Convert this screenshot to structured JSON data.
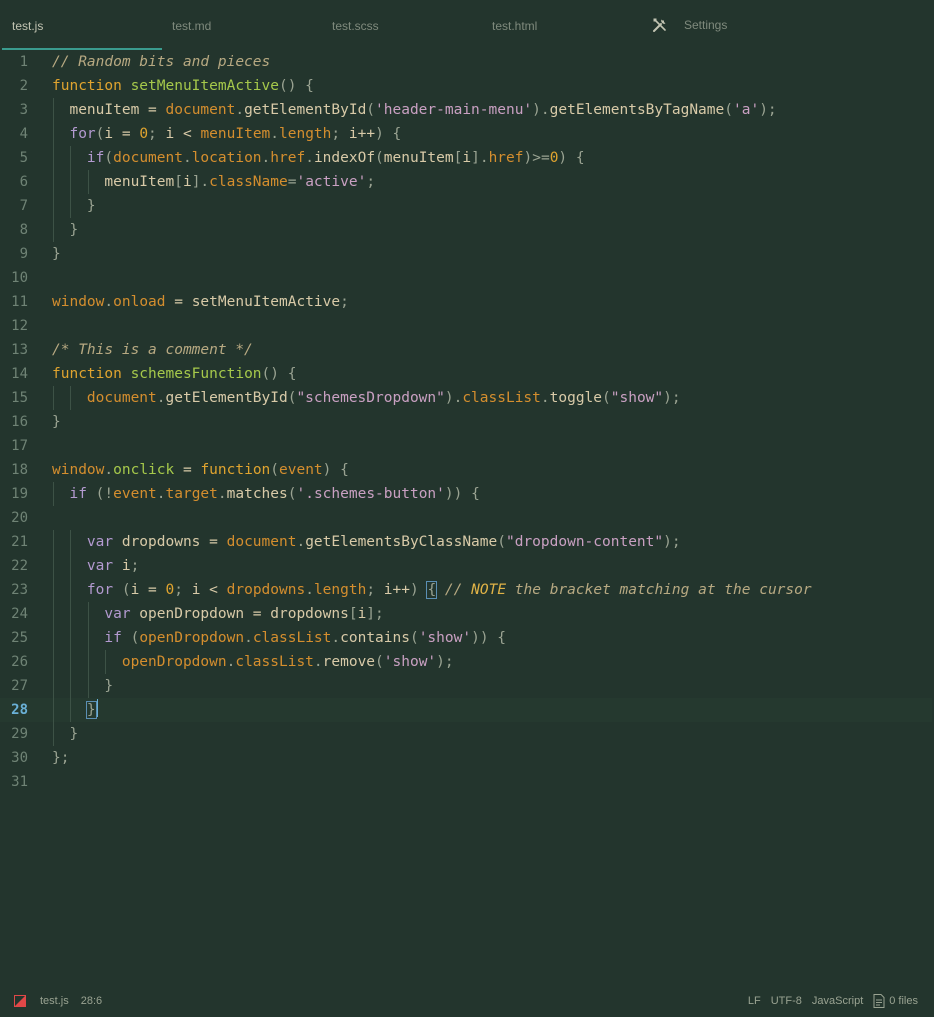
{
  "tabs": [
    {
      "label": "test.js",
      "active": true
    },
    {
      "label": "test.md",
      "active": false
    },
    {
      "label": "test.scss",
      "active": false
    },
    {
      "label": "test.html",
      "active": false
    },
    {
      "label": "Settings",
      "active": false,
      "icon": "tools-icon"
    }
  ],
  "editor": {
    "current_line": 28,
    "lines": [
      [
        [
          "cmt",
          "// Random bits and pieces"
        ]
      ],
      [
        [
          "kw",
          "function"
        ],
        [
          "txt",
          " "
        ],
        [
          "fn",
          "setMenuItemActive"
        ],
        [
          "pun",
          "() {"
        ]
      ],
      [
        [
          "txt",
          "  menuItem = "
        ],
        [
          "obj",
          "document"
        ],
        [
          "pun",
          "."
        ],
        [
          "txt",
          "getElementById"
        ],
        [
          "pun",
          "("
        ],
        [
          "str",
          "'header-main-menu'"
        ],
        [
          "pun",
          ")."
        ],
        [
          "txt",
          "getElementsByTagName"
        ],
        [
          "pun",
          "("
        ],
        [
          "str",
          "'a'"
        ],
        [
          "pun",
          ");"
        ]
      ],
      [
        [
          "for",
          "  for"
        ],
        [
          "pun",
          "("
        ],
        [
          "txt",
          "i = "
        ],
        [
          "num",
          "0"
        ],
        [
          "pun",
          "; "
        ],
        [
          "txt",
          "i < "
        ],
        [
          "obj",
          "menuItem"
        ],
        [
          "pun",
          "."
        ],
        [
          "prop",
          "length"
        ],
        [
          "pun",
          "; "
        ],
        [
          "txt",
          "i++"
        ],
        [
          "pun",
          ") {"
        ]
      ],
      [
        [
          "for",
          "    if"
        ],
        [
          "pun",
          "("
        ],
        [
          "obj",
          "document"
        ],
        [
          "pun",
          "."
        ],
        [
          "prop",
          "location"
        ],
        [
          "pun",
          "."
        ],
        [
          "prop",
          "href"
        ],
        [
          "pun",
          "."
        ],
        [
          "txt",
          "indexOf"
        ],
        [
          "pun",
          "("
        ],
        [
          "txt",
          "menuItem"
        ],
        [
          "pun",
          "["
        ],
        [
          "txt",
          "i"
        ],
        [
          "pun",
          "]."
        ],
        [
          "prop",
          "href"
        ],
        [
          "pun",
          ")>="
        ],
        [
          "num",
          "0"
        ],
        [
          "pun",
          ") {"
        ]
      ],
      [
        [
          "txt",
          "      menuItem"
        ],
        [
          "pun",
          "["
        ],
        [
          "txt",
          "i"
        ],
        [
          "pun",
          "]."
        ],
        [
          "prop",
          "className"
        ],
        [
          "pun",
          "="
        ],
        [
          "str",
          "'active'"
        ],
        [
          "pun",
          ";"
        ]
      ],
      [
        [
          "pun",
          "    }"
        ]
      ],
      [
        [
          "pun",
          "  }"
        ]
      ],
      [
        [
          "pun",
          "}"
        ]
      ],
      [
        [
          "txt",
          ""
        ]
      ],
      [
        [
          "obj",
          "window"
        ],
        [
          "pun",
          "."
        ],
        [
          "prop",
          "onload"
        ],
        [
          "txt",
          " = setMenuItemActive"
        ],
        [
          "pun",
          ";"
        ]
      ],
      [
        [
          "txt",
          ""
        ]
      ],
      [
        [
          "cmt",
          "/* This is a comment */"
        ]
      ],
      [
        [
          "kw",
          "function"
        ],
        [
          "txt",
          " "
        ],
        [
          "fn",
          "schemesFunction"
        ],
        [
          "pun",
          "() {"
        ]
      ],
      [
        [
          "txt",
          "    "
        ],
        [
          "obj",
          "document"
        ],
        [
          "pun",
          "."
        ],
        [
          "txt",
          "getElementById"
        ],
        [
          "pun",
          "("
        ],
        [
          "str",
          "\"schemesDropdown\""
        ],
        [
          "pun",
          ")."
        ],
        [
          "prop",
          "classList"
        ],
        [
          "pun",
          "."
        ],
        [
          "txt",
          "toggle"
        ],
        [
          "pun",
          "("
        ],
        [
          "str",
          "\"show\""
        ],
        [
          "pun",
          ");"
        ]
      ],
      [
        [
          "pun",
          "}"
        ]
      ],
      [
        [
          "txt",
          ""
        ]
      ],
      [
        [
          "obj",
          "window"
        ],
        [
          "pun",
          "."
        ],
        [
          "fn",
          "onclick"
        ],
        [
          "txt",
          " = "
        ],
        [
          "kw",
          "function"
        ],
        [
          "pun",
          "("
        ],
        [
          "obj",
          "event"
        ],
        [
          "pun",
          ") {"
        ]
      ],
      [
        [
          "for",
          "  if"
        ],
        [
          "pun",
          " ("
        ],
        [
          "pun",
          "!"
        ],
        [
          "obj",
          "event"
        ],
        [
          "pun",
          "."
        ],
        [
          "prop",
          "target"
        ],
        [
          "pun",
          "."
        ],
        [
          "txt",
          "matches"
        ],
        [
          "pun",
          "("
        ],
        [
          "str",
          "'.schemes-button'"
        ],
        [
          "pun",
          "))"
        ],
        [
          "pun",
          " {"
        ]
      ],
      [
        [
          "txt",
          ""
        ]
      ],
      [
        [
          "for",
          "    var"
        ],
        [
          "txt",
          " dropdowns = "
        ],
        [
          "obj",
          "document"
        ],
        [
          "pun",
          "."
        ],
        [
          "txt",
          "getElementsByClassName"
        ],
        [
          "pun",
          "("
        ],
        [
          "str",
          "\"dropdown-content\""
        ],
        [
          "pun",
          ");"
        ]
      ],
      [
        [
          "for",
          "    var"
        ],
        [
          "txt",
          " i"
        ],
        [
          "pun",
          ";"
        ]
      ],
      [
        [
          "for",
          "    for"
        ],
        [
          "pun",
          " ("
        ],
        [
          "txt",
          "i = "
        ],
        [
          "num",
          "0"
        ],
        [
          "pun",
          "; "
        ],
        [
          "txt",
          "i < "
        ],
        [
          "obj",
          "dropdowns"
        ],
        [
          "pun",
          "."
        ],
        [
          "prop",
          "length"
        ],
        [
          "pun",
          "; "
        ],
        [
          "txt",
          "i++"
        ],
        [
          "pun",
          ") "
        ],
        [
          "brk",
          "{"
        ],
        [
          "cmt",
          " // "
        ],
        [
          "note",
          "NOTE"
        ],
        [
          "cmt",
          " the bracket matching at the cursor"
        ]
      ],
      [
        [
          "for",
          "      var"
        ],
        [
          "txt",
          " openDropdown = dropdowns"
        ],
        [
          "pun",
          "["
        ],
        [
          "txt",
          "i"
        ],
        [
          "pun",
          "];"
        ]
      ],
      [
        [
          "for",
          "      if"
        ],
        [
          "pun",
          " ("
        ],
        [
          "obj",
          "openDropdown"
        ],
        [
          "pun",
          "."
        ],
        [
          "prop",
          "classList"
        ],
        [
          "pun",
          "."
        ],
        [
          "txt",
          "contains"
        ],
        [
          "pun",
          "("
        ],
        [
          "str",
          "'show'"
        ],
        [
          "pun",
          ")) {"
        ]
      ],
      [
        [
          "obj",
          "        openDropdown"
        ],
        [
          "pun",
          "."
        ],
        [
          "prop",
          "classList"
        ],
        [
          "pun",
          "."
        ],
        [
          "txt",
          "remove"
        ],
        [
          "pun",
          "("
        ],
        [
          "str",
          "'show'"
        ],
        [
          "pun",
          ");"
        ]
      ],
      [
        [
          "pun",
          "      }"
        ]
      ],
      [
        [
          "txt",
          "    "
        ],
        [
          "brk2",
          "}"
        ],
        [
          "cursor",
          ""
        ]
      ],
      [
        [
          "pun",
          "  }"
        ]
      ],
      [
        [
          "pun",
          "};"
        ]
      ],
      [
        [
          "txt",
          ""
        ]
      ]
    ]
  },
  "status": {
    "error_icon": "error-icon",
    "file": "test.js",
    "position": "28:6",
    "line_ending": "LF",
    "encoding": "UTF-8",
    "language": "JavaScript",
    "files_icon": "files-icon",
    "files": "0 files"
  }
}
